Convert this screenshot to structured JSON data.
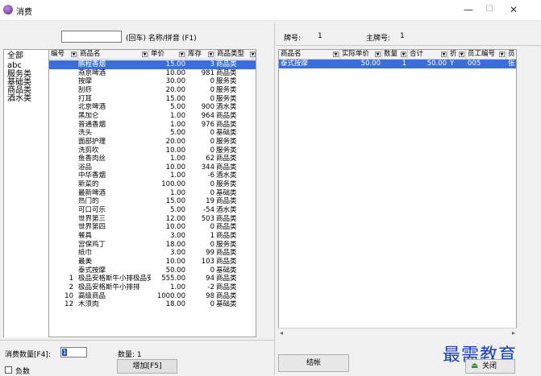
{
  "window": {
    "title": "消费",
    "minimize": "—",
    "maximize": "☐",
    "close": "✕"
  },
  "search": {
    "value": "",
    "hint": "(回车) 名称/拼音 (F1)"
  },
  "categories": [
    "全部",
    "abc",
    "服务类",
    "基础类",
    "商品类",
    "酒水类"
  ],
  "product_table": {
    "columns": [
      "编号",
      "商品名",
      "单价",
      "库存",
      "商品类型"
    ],
    "rows": [
      {
        "id": "",
        "name": "鹏程香烟",
        "price": "15.00",
        "stock": "3",
        "type": "商品类"
      },
      {
        "id": "",
        "name": "燕京啤酒",
        "price": "10.00",
        "stock": "981",
        "type": "商品类"
      },
      {
        "id": "",
        "name": "按摩",
        "price": "30.00",
        "stock": "0",
        "type": "服务类"
      },
      {
        "id": "",
        "name": "刮痧",
        "price": "20.00",
        "stock": "0",
        "type": "服务类"
      },
      {
        "id": "",
        "name": "打耳",
        "price": "15.00",
        "stock": "0",
        "type": "服务类"
      },
      {
        "id": "",
        "name": "北京啤酒",
        "price": "5.00",
        "stock": "900",
        "type": "酒水类"
      },
      {
        "id": "",
        "name": "黑加仑",
        "price": "1.00",
        "stock": "964",
        "type": "商品类"
      },
      {
        "id": "",
        "name": "普通香烟",
        "price": "1.00",
        "stock": "976",
        "type": "商品类"
      },
      {
        "id": "",
        "name": "洗头",
        "price": "5.00",
        "stock": "0",
        "type": "基础类"
      },
      {
        "id": "",
        "name": "面部护理",
        "price": "20.00",
        "stock": "0",
        "type": "服务类"
      },
      {
        "id": "",
        "name": "洗剪吹",
        "price": "10.00",
        "stock": "0",
        "type": "服务类"
      },
      {
        "id": "",
        "name": "鱼香肉丝",
        "price": "1.00",
        "stock": "62",
        "type": "商品类"
      },
      {
        "id": "",
        "name": "浴品",
        "price": "10.00",
        "stock": "344",
        "type": "商品类"
      },
      {
        "id": "",
        "name": "中华香烟",
        "price": "1.00",
        "stock": "-6",
        "type": "酒水类"
      },
      {
        "id": "",
        "name": "新菜的",
        "price": "100.00",
        "stock": "0",
        "type": "服务类"
      },
      {
        "id": "",
        "name": "最新啤酒",
        "price": "1.00",
        "stock": "0",
        "type": "基础类"
      },
      {
        "id": "",
        "name": "热门的",
        "price": "15.00",
        "stock": "19",
        "type": "商品类"
      },
      {
        "id": "",
        "name": "可口可乐",
        "price": "5.00",
        "stock": "-54",
        "type": "酒水类"
      },
      {
        "id": "",
        "name": "世界第三",
        "price": "12.00",
        "stock": "503",
        "type": "商品类"
      },
      {
        "id": "",
        "name": "世界第四",
        "price": "10.00",
        "stock": "0",
        "type": "商品类"
      },
      {
        "id": "",
        "name": "餐具",
        "price": "3.00",
        "stock": "1",
        "type": "商品类"
      },
      {
        "id": "",
        "name": "宫保鸡丁",
        "price": "18.00",
        "stock": "0",
        "type": "服务类"
      },
      {
        "id": "",
        "name": "纸巾",
        "price": "3.00",
        "stock": "99",
        "type": "商品类"
      },
      {
        "id": "",
        "name": "最美",
        "price": "10.00",
        "stock": "103",
        "type": "商品类"
      },
      {
        "id": "",
        "name": "泰式按摩",
        "price": "50.00",
        "stock": "0",
        "type": "基础类"
      },
      {
        "id": "1",
        "name": "极品安格斯牛小排极品安格",
        "price": "555.00",
        "stock": "94",
        "type": "商品类"
      },
      {
        "id": "2",
        "name": "极品安格斯牛小排排",
        "price": "1.00",
        "stock": "-2",
        "type": "商品类"
      },
      {
        "id": "10",
        "name": "高级商品",
        "price": "1000.00",
        "stock": "98",
        "type": "商品类"
      },
      {
        "id": "12",
        "name": "木须肉",
        "price": "18.00",
        "stock": "0",
        "type": "基础类"
      }
    ]
  },
  "order_header": {
    "table_no_label": "牌号:",
    "table_no": "1",
    "main_table_label": "主牌号:",
    "main_table_no": "1"
  },
  "order_table": {
    "columns": [
      "商品名",
      "实际单价",
      "数量",
      "合计",
      "折",
      "员工编号",
      "员"
    ],
    "rows": [
      {
        "name": "泰式按摩",
        "unit_price": "50.00",
        "qty": "1",
        "total": "50.00",
        "discount": "Y",
        "staff_id": "005",
        "staff": "张"
      }
    ]
  },
  "bottom": {
    "qty_label": "消费数量[F4]:",
    "qty_value": "1",
    "count_label": "数量:",
    "count_value": "1",
    "negative_label": "负数",
    "add_button": "增加[F5]",
    "settle_button": "结帐",
    "close_button": "关闭"
  },
  "watermark": "最需教育",
  "colors": {
    "selection": "#3a6fd8",
    "window_bg": "#f0f0f0"
  }
}
